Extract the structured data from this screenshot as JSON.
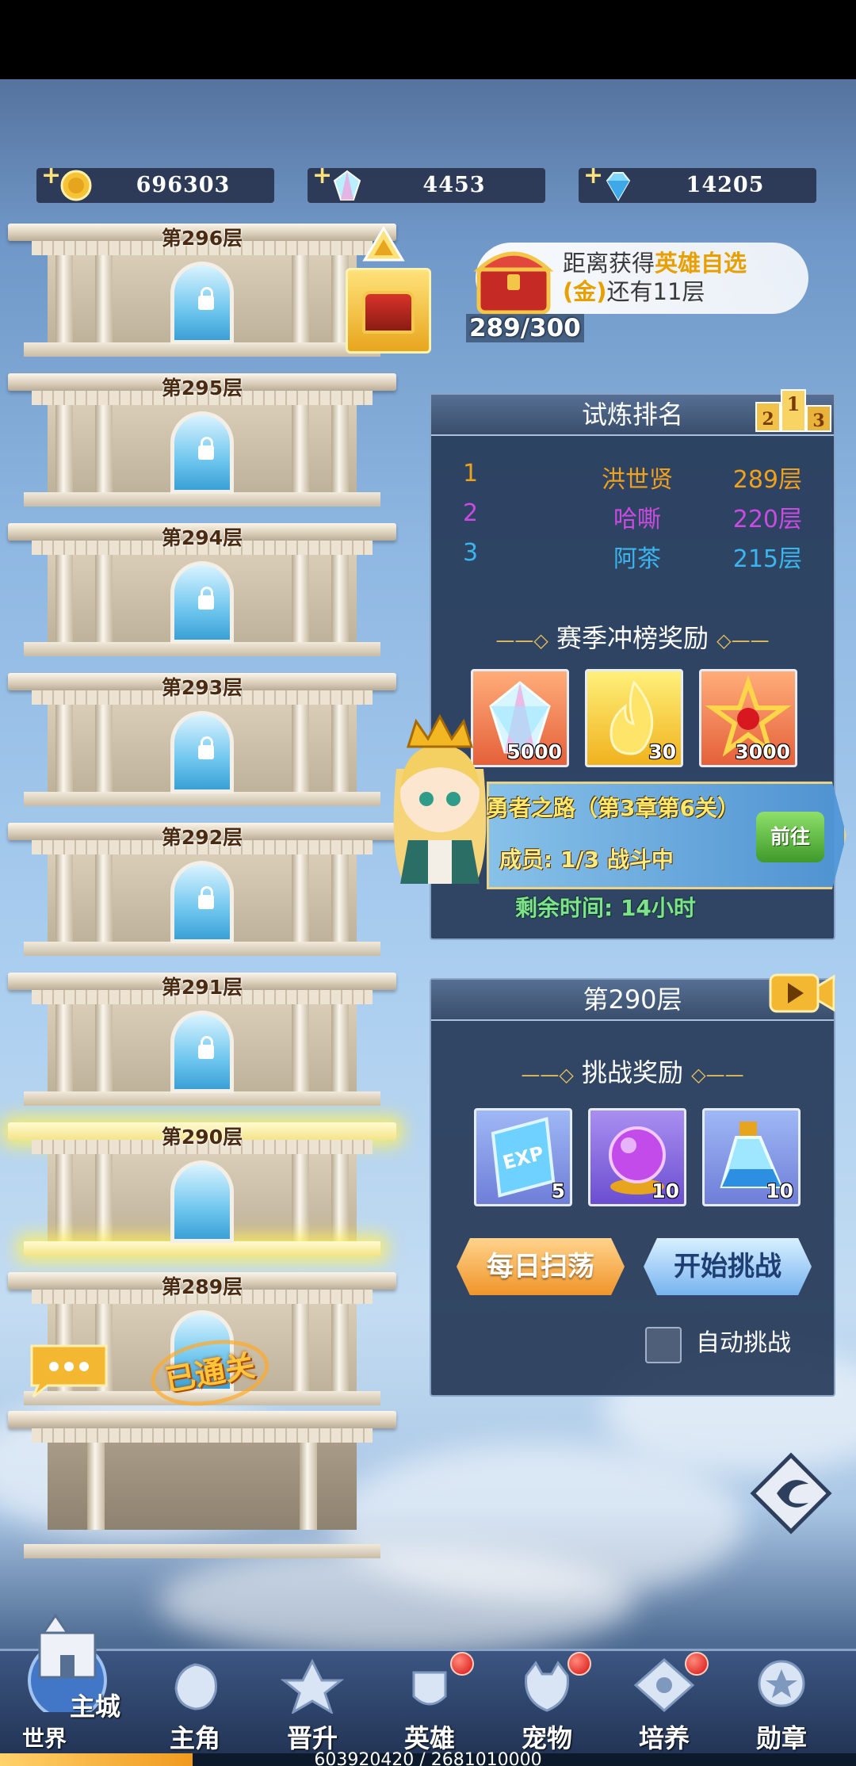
{
  "resources": {
    "gold": "696303",
    "rainbow_gem": "4453",
    "diamond": "14205"
  },
  "tower": {
    "floors": [
      {
        "label": "第296层",
        "locked": true
      },
      {
        "label": "第295层",
        "locked": true
      },
      {
        "label": "第294层",
        "locked": true
      },
      {
        "label": "第293层",
        "locked": true
      },
      {
        "label": "第292层",
        "locked": true
      },
      {
        "label": "第291层",
        "locked": true
      },
      {
        "label": "第290层",
        "locked": false
      },
      {
        "label": "第289层",
        "locked": false
      }
    ],
    "cleared_stamp": "已通关"
  },
  "goal": {
    "text_prefix": "距离获得",
    "highlight": "英雄自选",
    "highlight2": "(金)",
    "text_suffix": "还有11层",
    "progress": "289/300"
  },
  "ranking": {
    "title": "试炼排名",
    "podium": [
      "2",
      "1",
      "3"
    ],
    "rows": [
      {
        "rank": "1",
        "name": "洪世贤",
        "floor": "289层",
        "color": "#f0a11c"
      },
      {
        "rank": "2",
        "name": "哈嘶",
        "floor": "220层",
        "color": "#c94be0"
      },
      {
        "rank": "3",
        "name": "阿茶",
        "floor": "215层",
        "color": "#3bb5f0"
      }
    ],
    "season_title": "赛季冲榜奖励",
    "season_rewards": [
      {
        "icon": "rainbow-gem-icon",
        "count": "5000"
      },
      {
        "icon": "golden-flame-icon",
        "count": "30"
      },
      {
        "icon": "red-star-emblem-icon",
        "count": "3000"
      }
    ]
  },
  "adventure": {
    "title": "勇者之路（第3章第6关）",
    "members": "成员: 1/3   战斗中",
    "go_label": "前往",
    "remaining": "剩余时间: 14小时"
  },
  "stage": {
    "title": "第290层",
    "reward_title": "挑战奖励",
    "rewards": [
      {
        "icon": "exp-crystal-icon",
        "count": "5"
      },
      {
        "icon": "purple-orb-icon",
        "count": "10"
      },
      {
        "icon": "blue-potion-icon",
        "count": "10"
      }
    ],
    "sweep_label": "每日扫荡",
    "challenge_label": "开始挑战",
    "auto_label": "自动挑战"
  },
  "nav": {
    "home_top": "主城",
    "home_bottom": "世界",
    "items": [
      {
        "label": "主角",
        "dot": false
      },
      {
        "label": "晋升",
        "dot": false
      },
      {
        "label": "英雄",
        "dot": true
      },
      {
        "label": "宠物",
        "dot": true
      },
      {
        "label": "培养",
        "dot": true
      },
      {
        "label": "勋章",
        "dot": false
      }
    ]
  },
  "xp": {
    "text": "603920420 / 2681010000",
    "fraction": 0.2253
  }
}
